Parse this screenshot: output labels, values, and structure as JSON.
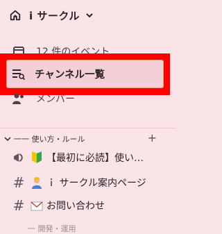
{
  "header": {
    "workspace_name": "i サークル"
  },
  "nav": {
    "events_label": "12 件のイベント",
    "channels_label": "チャンネル一覧",
    "members_label": "メンバー"
  },
  "section": {
    "title": "一一 使い方・ルール",
    "add_symbol": "+"
  },
  "channels": [
    {
      "label": "【最初に必読】使い…",
      "icon": "beginner-mark-icon"
    },
    {
      "label": "ｉ サークル案内ページ",
      "icon": "person-icon"
    },
    {
      "label": "お問い合わせ",
      "icon": "envelope-icon"
    }
  ],
  "footer": {
    "partial_label": "一 開発・運用"
  },
  "colors": {
    "background": "#fae4e8",
    "highlight": "#ff0000",
    "selected_bg": "#f3d0d7",
    "selected_border": "#d9a56a"
  }
}
